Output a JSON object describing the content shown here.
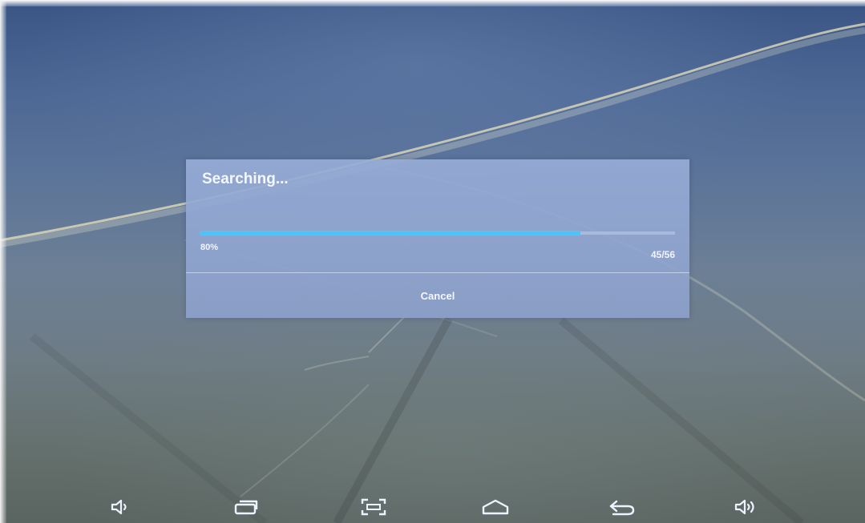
{
  "dialog": {
    "title": "Searching...",
    "progress_percent_label": "80%",
    "progress_fraction": 0.8,
    "progress_count": "45/56",
    "cancel_label": "Cancel"
  },
  "navbar": {
    "icons": [
      "volume-down-icon",
      "recent-apps-icon",
      "screenshot-icon",
      "home-icon",
      "back-icon",
      "volume-up-icon"
    ]
  },
  "colors": {
    "progress_fill": "#45c6ff",
    "dialog_bg": "#96acd6",
    "text": "#f4f7ff"
  }
}
